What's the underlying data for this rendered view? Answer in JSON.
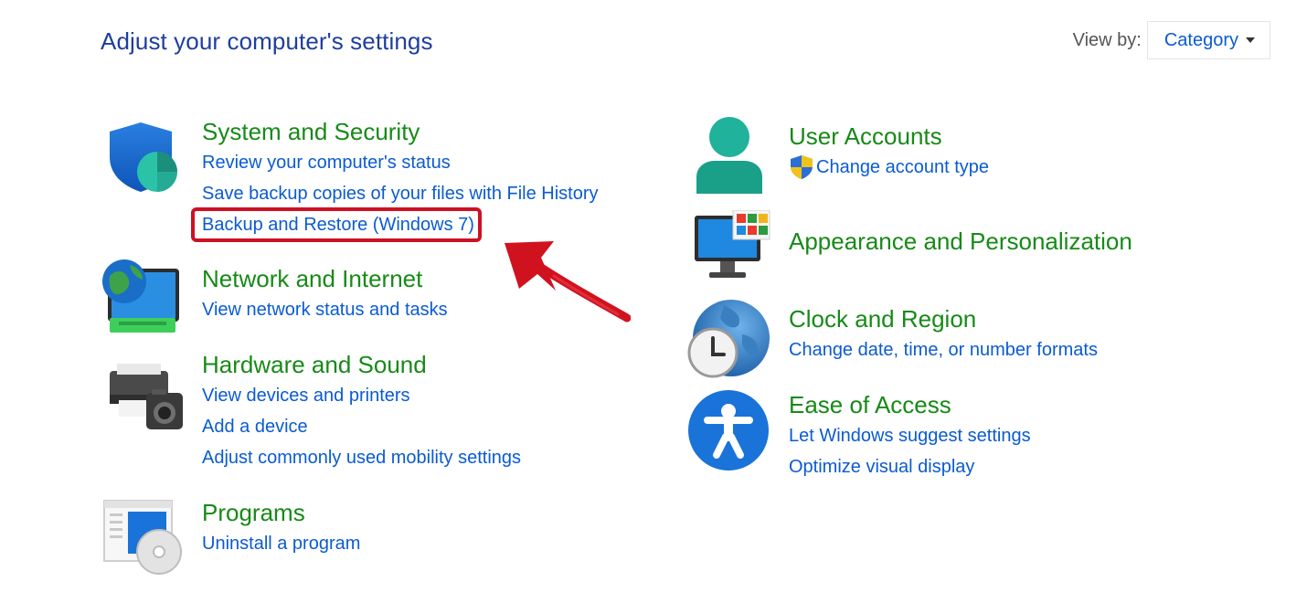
{
  "page": {
    "title": "Adjust your computer's settings"
  },
  "view_by": {
    "label": "View by:",
    "value": "Category"
  },
  "categories": {
    "system_security": {
      "title": "System and Security",
      "links": [
        "Review your computer's status",
        "Save backup copies of your files with File History",
        "Backup and Restore (Windows 7)"
      ]
    },
    "network_internet": {
      "title": "Network and Internet",
      "links": [
        "View network status and tasks"
      ]
    },
    "hardware_sound": {
      "title": "Hardware and Sound",
      "links": [
        "View devices and printers",
        "Add a device",
        "Adjust commonly used mobility settings"
      ]
    },
    "programs": {
      "title": "Programs",
      "links": [
        "Uninstall a program"
      ]
    },
    "user_accounts": {
      "title": "User Accounts",
      "links": [
        "Change account type"
      ]
    },
    "appearance": {
      "title": "Appearance and Personalization",
      "links": []
    },
    "clock_region": {
      "title": "Clock and Region",
      "links": [
        "Change date, time, or number formats"
      ]
    },
    "ease_access": {
      "title": "Ease of Access",
      "links": [
        "Let Windows suggest settings",
        "Optimize visual display"
      ]
    }
  },
  "colors": {
    "title_blue": "#1f3e9e",
    "category_green": "#178a17",
    "link_blue": "#0a5bd2",
    "highlight_red": "#cc1122"
  }
}
